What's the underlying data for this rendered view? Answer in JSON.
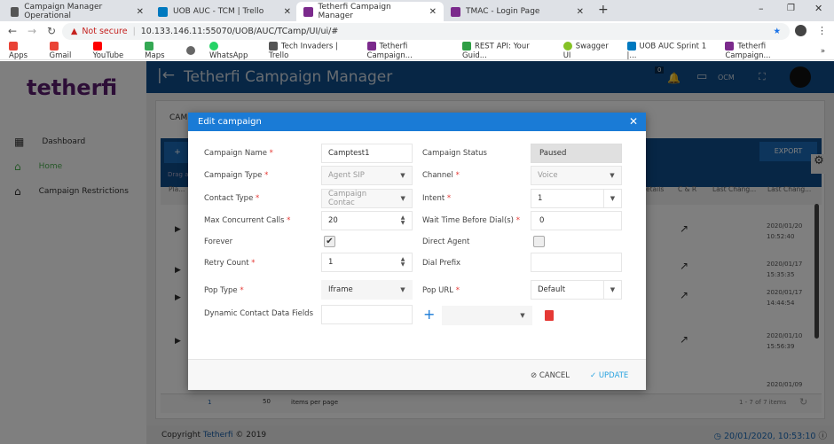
{
  "browser": {
    "tabs": [
      {
        "title": "Campaign Manager Operational"
      },
      {
        "title": "UOB AUC - TCM | Trello"
      },
      {
        "title": "Tetherfi Campaign Manager",
        "active": true
      },
      {
        "title": "TMAC - Login Page"
      }
    ],
    "security": "Not secure",
    "url": "10.133.146.11:55070/UOB/AUC/TCamp/UI/ui/#",
    "bookmarks": [
      "Apps",
      "Gmail",
      "YouTube",
      "Maps",
      "WhatsApp",
      "Tech Invaders | Trello",
      "Tetherfi Campaign...",
      "REST API: Your Guid...",
      "Swagger UI",
      "UOB AUC Sprint 1 |...",
      "Tetherfi Campaign..."
    ]
  },
  "logo": "tetherfi",
  "sidebar": {
    "items": [
      {
        "label": "Dashboard",
        "icon": "dashboard-icon"
      },
      {
        "label": "Home",
        "icon": "home-icon",
        "active": true
      },
      {
        "label": "Campaign Restrictions",
        "icon": "home-icon"
      }
    ]
  },
  "header": {
    "title": "Tetherfi Campaign Manager",
    "notifications": "0",
    "ocm": "OCM"
  },
  "background": {
    "tab": "CAMP",
    "add": "+",
    "export": "EXPORT",
    "drag": "Drag a",
    "cols": [
      "Pla...",
      "etails",
      "C & R",
      "Last Chang...",
      "Last Chang..."
    ],
    "rows": [
      {
        "date": "2020/01/20",
        "time": "10:52:40"
      },
      {
        "date": "2020/01/17",
        "time": "15:35:35"
      },
      {
        "date": "2020/01/17",
        "time": "14:44:54"
      },
      {
        "date": "2020/01/10",
        "time": "15:56:39"
      },
      {
        "date": "2020/01/09",
        "time": ""
      }
    ],
    "pager": {
      "page": "1",
      "size": "50",
      "per_page": "items per page",
      "summary": "1 - 7 of 7 items"
    }
  },
  "footer": {
    "copyright": "Copyright",
    "brand": "Tetherfi",
    "year": "© 2019",
    "datetime": "20/01/2020, 10:53:10"
  },
  "modal": {
    "title": "Edit campaign",
    "fields": {
      "campaign_name": {
        "label": "Campaign Name",
        "value": "Camptest1"
      },
      "campaign_status": {
        "label": "Campaign Status",
        "value": "Paused"
      },
      "campaign_type": {
        "label": "Campaign Type",
        "value": "Agent SIP"
      },
      "channel": {
        "label": "Channel",
        "value": "Voice"
      },
      "contact_type": {
        "label": "Contact Type",
        "value": "Campaign Contac"
      },
      "intent": {
        "label": "Intent",
        "value": "1"
      },
      "max_calls": {
        "label": "Max Concurrent Calls",
        "value": "20"
      },
      "wait_time": {
        "label": "Wait Time Before Dial(s)",
        "value": "0"
      },
      "forever": {
        "label": "Forever",
        "checked": true
      },
      "direct_agent": {
        "label": "Direct Agent",
        "checked": false
      },
      "retry_count": {
        "label": "Retry Count",
        "value": "1"
      },
      "dial_prefix": {
        "label": "Dial Prefix",
        "value": ""
      },
      "pop_type": {
        "label": "Pop Type",
        "value": "Iframe"
      },
      "pop_url": {
        "label": "Pop URL",
        "value": "Default"
      },
      "dynamic_fields": {
        "label": "Dynamic Contact Data Fields",
        "value": ""
      }
    },
    "cancel": "CANCEL",
    "update": "UPDATE"
  }
}
